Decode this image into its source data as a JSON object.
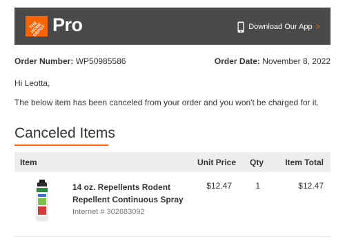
{
  "header": {
    "logo_text": "THE HOME DEPOT",
    "logo_icon": "home-depot-logo",
    "brand": "Pro",
    "download_app_label": "Download Our App",
    "download_app_chevron": ">",
    "phone_icon": "smartphone-icon",
    "background_color": "#4a4a4a",
    "accent_color": "#f96302"
  },
  "order": {
    "number_label": "Order Number:",
    "number_value": "WP50985586",
    "date_label": "Order Date:",
    "date_value": "November 8, 2022"
  },
  "greeting": "Hi Leotta,",
  "message": "The below item has been canceled from your order and you won't be charged for it.",
  "section": {
    "title": "Canceled Items"
  },
  "table": {
    "headers": {
      "item": "Item",
      "unit_price": "Unit Price",
      "qty": "Qty",
      "item_total": "Item Total"
    },
    "rows": [
      {
        "name": "14 oz. Repellents Rodent Repellent Continuous Spray",
        "internet_number": "Internet # 302683092",
        "unit_price": "$12.47",
        "qty": "1",
        "item_total": "$12.47",
        "image_icon": "spray-can-product-image"
      }
    ]
  }
}
